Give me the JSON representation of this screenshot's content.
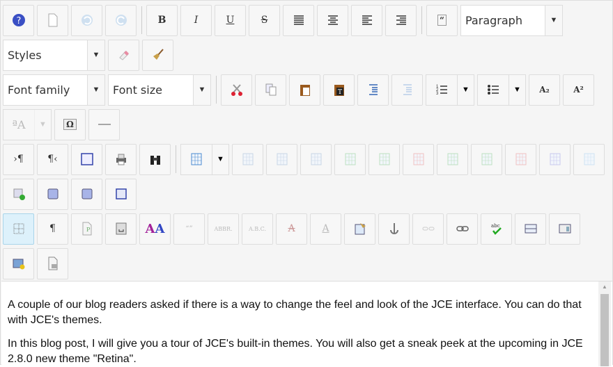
{
  "toolbar": {
    "format_select": "Paragraph",
    "styles_select": "Styles",
    "font_family_select": "Font family",
    "font_size_select": "Font size",
    "glyphs": {
      "bold": "B",
      "italic": "I",
      "underline": "U",
      "strike": "S",
      "pilcrow": "¶",
      "omega": "Ω",
      "subscript": "A₂",
      "superscript": "A²",
      "quote": "“”",
      "abbr": "ABBR.",
      "acronym": "A.B.C.",
      "spell": "abc"
    },
    "dropdown_arrow": "▼",
    "active_button": "visual-aid",
    "accent_active": "#ddf1fb"
  },
  "content": {
    "paragraphs": [
      "A couple of our blog readers asked if there is a way to change the feel and look of the JCE interface. You can do that with JCE's themes.",
      "In this blog post, I will give you a tour of JCE's built-in themes. You will also get a sneak peek at the upcoming in JCE 2.8.0 new theme \"Retina\"."
    ]
  }
}
